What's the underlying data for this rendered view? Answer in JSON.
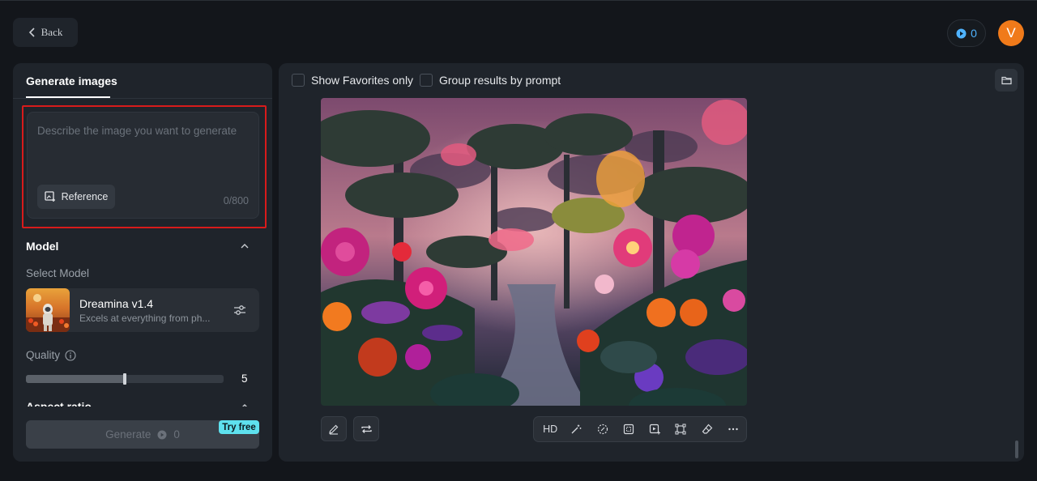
{
  "header": {
    "back_label": "Back",
    "credits": "0",
    "avatar_initial": "V"
  },
  "left": {
    "tab": "Generate images",
    "prompt": {
      "placeholder": "Describe the image you want to generate",
      "value": "",
      "char_count": "0/800",
      "reference_label": "Reference"
    },
    "model_section": {
      "title": "Model",
      "select_label": "Select Model",
      "model_name": "Dreamina v1.4",
      "model_desc": "Excels at everything from ph..."
    },
    "quality": {
      "label": "Quality",
      "value": "5",
      "fraction": 0.5
    },
    "aspect_title": "Aspect ratio",
    "generate": {
      "label": "Generate",
      "cost": "0",
      "badge": "Try free"
    }
  },
  "right": {
    "show_favorites_label": "Show Favorites only",
    "group_results_label": "Group results by prompt",
    "toolbar": {
      "hd_label": "HD",
      "icons": [
        "magic-wand-icon",
        "dashed-circle-icon",
        "dashed-square-icon",
        "video-plus-icon",
        "transform-icon",
        "eraser-icon",
        "more-icon"
      ]
    }
  },
  "colors": {
    "accent": "#5ee1ee",
    "highlight": "#d81b1b",
    "avatar": "#f07a1a",
    "credit": "#4fb3ff"
  }
}
